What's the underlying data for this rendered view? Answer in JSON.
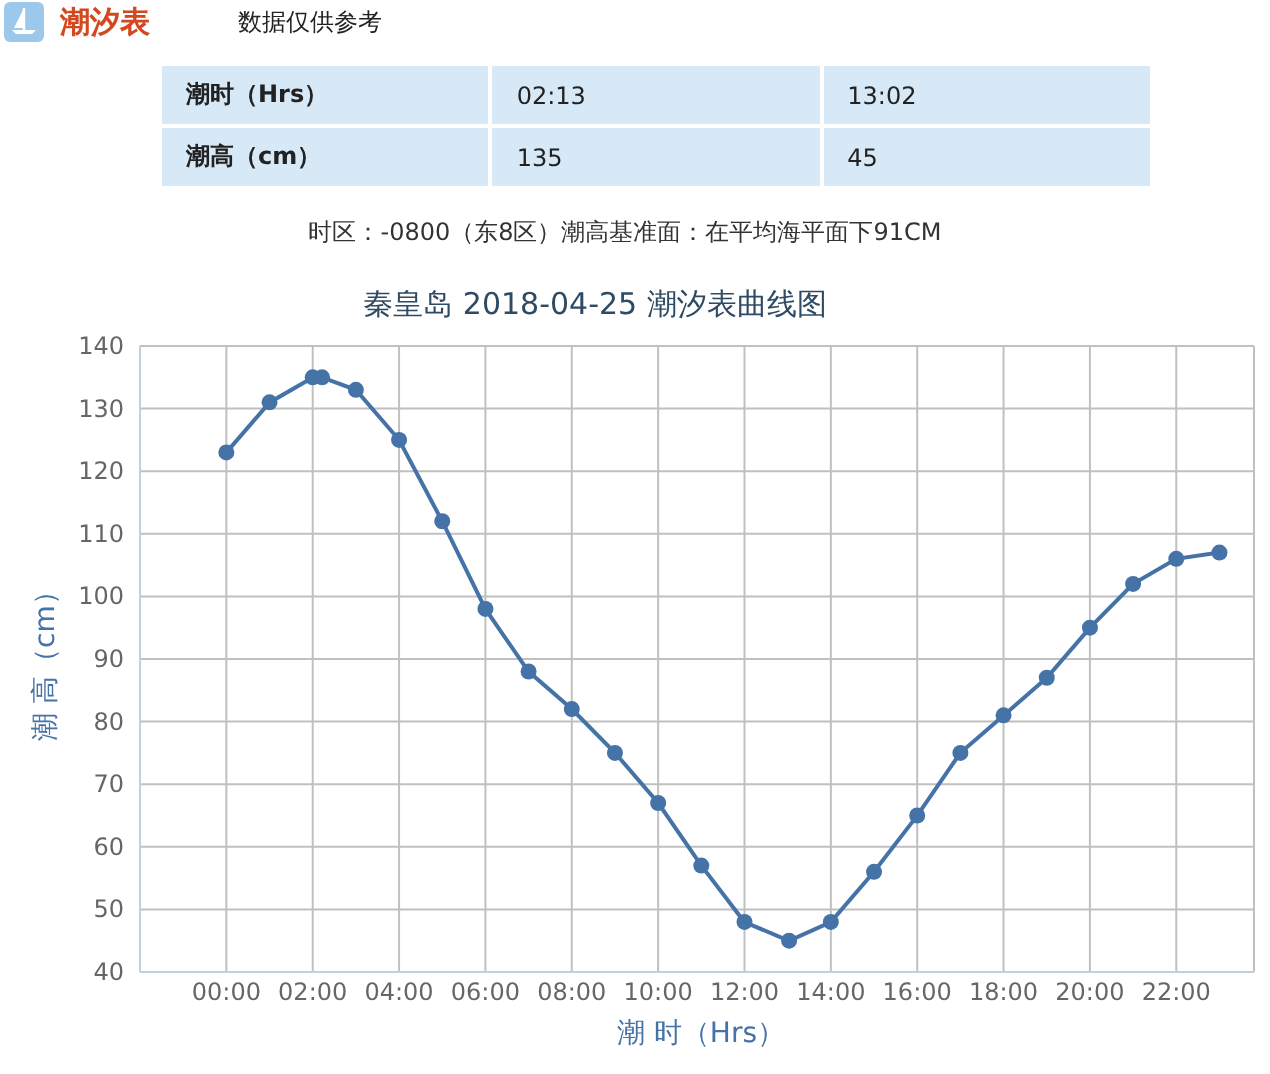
{
  "header": {
    "title": "潮汐表",
    "note": "数据仅供参考"
  },
  "tide_table": {
    "rows": [
      {
        "label": "潮时（Hrs）",
        "values": [
          "02:13",
          "13:02"
        ]
      },
      {
        "label": "潮高（cm）",
        "values": [
          "135",
          "45"
        ]
      }
    ]
  },
  "datum_note": "时区：-0800（东8区）潮高基准面：在平均海平面下91CM",
  "chart": {
    "chart_data": {
      "type": "line",
      "title": "秦皇岛 2018-04-25 潮汐表曲线图",
      "xlabel": "潮 时（Hrs）",
      "ylabel": "潮 高（cm）",
      "grid": true,
      "x": [
        0,
        1,
        2,
        2.217,
        3,
        4,
        5,
        6,
        7,
        8,
        9,
        10,
        11,
        12,
        13.033,
        14,
        15,
        16,
        17,
        18,
        19,
        20,
        21,
        22,
        23
      ],
      "series": [
        {
          "color": "#4572a7",
          "marker": true,
          "values": [
            123,
            131,
            135,
            135,
            133,
            125,
            112,
            98,
            88,
            82,
            75,
            67,
            57,
            48,
            45,
            48,
            56,
            65,
            75,
            81,
            87,
            95,
            102,
            106,
            107
          ]
        }
      ],
      "xlim": [
        -2,
        23.8
      ],
      "ylim": [
        40,
        140
      ],
      "xticks": [
        {
          "value": 0,
          "label": "00:00"
        },
        {
          "value": 2,
          "label": "02:00"
        },
        {
          "value": 4,
          "label": "04:00"
        },
        {
          "value": 6,
          "label": "06:00"
        },
        {
          "value": 8,
          "label": "08:00"
        },
        {
          "value": 10,
          "label": "10:00"
        },
        {
          "value": 12,
          "label": "12:00"
        },
        {
          "value": 14,
          "label": "14:00"
        },
        {
          "value": 16,
          "label": "16:00"
        },
        {
          "value": 18,
          "label": "18:00"
        },
        {
          "value": 20,
          "label": "20:00"
        },
        {
          "value": 22,
          "label": "22:00"
        }
      ],
      "yticks": [
        40,
        50,
        60,
        70,
        80,
        90,
        100,
        110,
        120,
        130,
        140
      ]
    }
  }
}
